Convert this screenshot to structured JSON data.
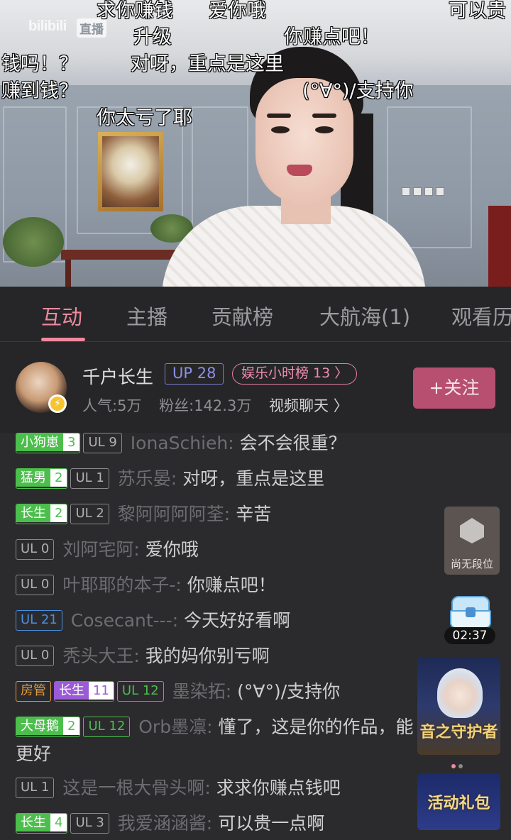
{
  "video": {
    "logo": "bilibili",
    "logo_badge": "直播",
    "danmaku": [
      "求你赚钱",
      "爱你哦",
      "可以贵",
      "升级",
      "你赚点吧！",
      "钱吗！？",
      "对呀，重点是这里",
      "赚到钱？",
      "(°∀°)/支持你",
      "你太亏了耶"
    ]
  },
  "tabs": [
    {
      "label": "互动",
      "active": true
    },
    {
      "label": "主播",
      "active": false
    },
    {
      "label": "贡献榜",
      "active": false
    },
    {
      "label": "大航海(1)",
      "active": false
    },
    {
      "label": "观看历",
      "active": false
    }
  ],
  "streamer": {
    "name": "千户长生",
    "up_level": "UP 28",
    "rank": "娱乐小时榜 13 〉",
    "popularity": "人气:5万",
    "fans": "粉丝:142.3万",
    "video_chat": "视频聊天 〉",
    "follow_label": "+关注",
    "avatar_badge_icon": "lightning-icon"
  },
  "chat": [
    {
      "medal": "小狗崽",
      "medal_level": "3",
      "ul": "UL 9",
      "ul_color": "gray",
      "user": "IonaSchieh:",
      "text": "会不会很重？"
    },
    {
      "medal": "猛男",
      "medal_level": "2",
      "ul": "UL 1",
      "ul_color": "gray",
      "user": "苏乐晏:",
      "text": "对呀，重点是这里"
    },
    {
      "medal": "长生",
      "medal_level": "2",
      "ul": "UL 2",
      "ul_color": "gray",
      "user": "黎阿阿阿阿荃:",
      "text": "辛苦"
    },
    {
      "ul": "UL 0",
      "ul_color": "gray",
      "user": "刘阿宅阿:",
      "text": "爱你哦"
    },
    {
      "ul": "UL 0",
      "ul_color": "gray",
      "user": "叶耶耶的本子-:",
      "text": "你赚点吧！"
    },
    {
      "ul": "UL 21",
      "ul_color": "blue",
      "user": "Cosecant---:",
      "text": "今天好好看啊"
    },
    {
      "ul": "UL 0",
      "ul_color": "gray",
      "user": "秃头大王:",
      "text": "我的妈你别亏啊"
    },
    {
      "admin": "房管",
      "medal": "长生",
      "medal_level": "11",
      "medal_color": "purple",
      "ul": "UL 12",
      "ul_color": "green",
      "user": "墨染拓:",
      "text": "(°∀°)/支持你"
    },
    {
      "medal": "大母鹅",
      "medal_level": "2",
      "ul": "UL 12",
      "ul_color": "green",
      "user": "Orb墨凛:",
      "text": "懂了，这是你的作品，能更好"
    },
    {
      "ul": "UL 1",
      "ul_color": "gray",
      "user": "这是一根大骨头啊:",
      "text": "求求你赚点钱吧"
    },
    {
      "medal": "长生",
      "medal_level": "4",
      "ul": "UL 3",
      "ul_color": "gray",
      "user": "我爱涵涵酱:",
      "text": "可以贵一点啊"
    }
  ],
  "sidebar": {
    "rank_label": "尚无段位",
    "timer": "02:37",
    "promo1_title": "音之守护者",
    "promo2_title": "活动礼包"
  },
  "colors": {
    "accent_pink": "#f0899f",
    "follow_bg": "#b74f70",
    "fan_green": "#4cbe4c",
    "fan_purple": "#9b5ad6",
    "ul_blue": "#4a8fe0",
    "admin_orange": "#e69a3b"
  }
}
